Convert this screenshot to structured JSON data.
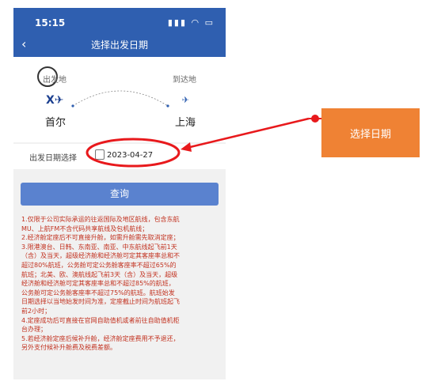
{
  "status_bar": {
    "time": "15:15",
    "icons": "▮▮▮ ◠ ▭"
  },
  "header": {
    "back": "‹",
    "title": "选择出发日期"
  },
  "route": {
    "from_label": "出发地",
    "to_label": "到达地",
    "from_city": "首尔",
    "to_city": "上海",
    "from_logo_glyph": "X✈",
    "to_logo_glyph": "✈"
  },
  "date_row": {
    "label": "出发日期选择",
    "value": "2023-04-27"
  },
  "query_button": "查询",
  "notes": [
    "1.仅限于公司实际承运的往返国际及地区航线，包含东航",
    "MU、上航FM不含代码共享航线及包机航线；",
    "2.经济舱定座后不可直接升舱，如需升舱需先取消定座；",
    "3.限港澳台、日韩、东南亚、南亚、中东航线起飞前1天",
    "（含）及当天，超级经济舱和经济舱可定其客座率总和不",
    "超过80%航班，公务舱可定公务舱客座率不超过65%的",
    "航班；北美、欧、澳航线起飞前3天（含）及当天，超级",
    "经济舱和经济舱可定其客座率总和不超过85%的航班，",
    "公务舱可定公务舱客座率不超过75%的航班。航班始发",
    "日期选择以当地始发时间为准，定座截止时间为航班起飞",
    "前2小时；",
    "4.定座成功后可直接在官网自助值机或者前往自助值机柜",
    "台办理；",
    "5.若经济舱定座后候补升舱，经济舱定座费用不予退还，",
    "另外支付候补升舱费及税费差额。"
  ],
  "annotation": {
    "label": "选择日期",
    "color": "#ef8234",
    "marker_color": "#e8191c"
  },
  "colors": {
    "header": "#2f5fb0",
    "button": "#5a82cf",
    "notes_text": "#c2311f"
  }
}
